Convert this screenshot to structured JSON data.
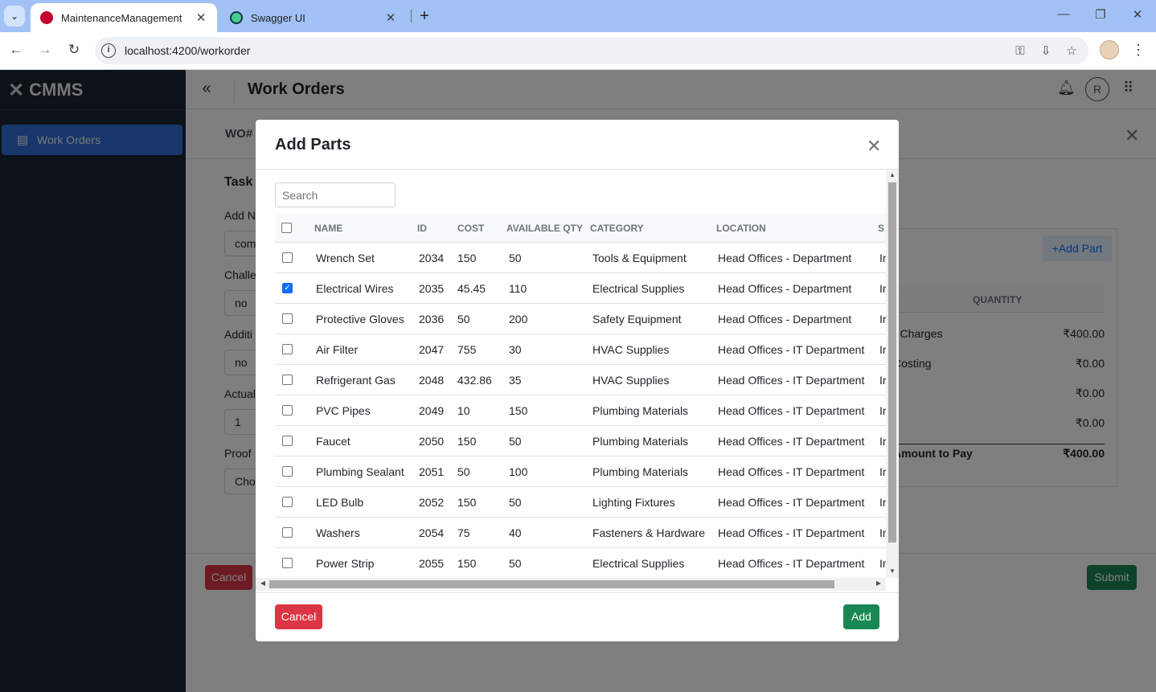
{
  "browser": {
    "tabs": [
      {
        "title": "MaintenanceManagement",
        "active": true
      },
      {
        "title": "Swagger UI",
        "active": false
      }
    ],
    "url": "localhost:4200/workorder",
    "icons": {
      "back": "←",
      "forward": "→",
      "reload": "↻",
      "key": "⚿",
      "install": "⇩",
      "star": "☆",
      "menu": "⋮",
      "close": "✕",
      "plus": "+",
      "minimize": "—",
      "restore": "❐"
    }
  },
  "sidebar": {
    "brand": "CMMS",
    "items": [
      {
        "label": "Work Orders",
        "icon": "clipboard-icon"
      }
    ]
  },
  "header": {
    "title": "Work Orders",
    "avatar_initial": "R"
  },
  "workorder": {
    "id_label": "WO#",
    "task_label": "Task",
    "fields": [
      {
        "label": "Add N",
        "value": "com"
      },
      {
        "label": "Challe",
        "value": "no"
      },
      {
        "label": "Additi",
        "value": "no"
      },
      {
        "label": "Actual",
        "value": "1"
      },
      {
        "label": "Proof",
        "value": "Cho"
      }
    ],
    "cancel_label": "Cancel",
    "submit_label": "Submit",
    "add_part_label": "+Add Part",
    "cost_columns": [
      "T",
      "QUANTITY"
    ],
    "cost_rows": [
      {
        "label": "r Charges",
        "value": "₹400.00"
      },
      {
        "label": "Costing",
        "value": "₹0.00"
      },
      {
        "label": "",
        "value": "₹0.00"
      },
      {
        "label": "",
        "value": "₹0.00"
      }
    ],
    "total": {
      "label": "Amount to Pay",
      "value": "₹400.00"
    }
  },
  "modal": {
    "title": "Add Parts",
    "search_placeholder": "Search",
    "columns": [
      "NAME",
      "ID",
      "COST",
      "AVAILABLE QTY",
      "CATEGORY",
      "LOCATION",
      "S"
    ],
    "rows": [
      {
        "name": "Wrench Set",
        "id": "2034",
        "cost": "150",
        "qty": "50",
        "category": "Tools & Equipment",
        "location": "Head Offices - Department",
        "status": "Ir",
        "checked": false
      },
      {
        "name": "Electrical Wires",
        "id": "2035",
        "cost": "45.45",
        "qty": "110",
        "category": "Electrical Supplies",
        "location": "Head Offices - Department",
        "status": "Ir",
        "checked": true
      },
      {
        "name": "Protective Gloves",
        "id": "2036",
        "cost": "50",
        "qty": "200",
        "category": "Safety Equipment",
        "location": "Head Offices - Department",
        "status": "Ir",
        "checked": false
      },
      {
        "name": "Air Filter",
        "id": "2047",
        "cost": "755",
        "qty": "30",
        "category": "HVAC Supplies",
        "location": "Head Offices - IT Department",
        "status": "Ir",
        "checked": false
      },
      {
        "name": "Refrigerant Gas",
        "id": "2048",
        "cost": "432.86",
        "qty": "35",
        "category": "HVAC Supplies",
        "location": "Head Offices - IT Department",
        "status": "Ir",
        "checked": false
      },
      {
        "name": "PVC Pipes",
        "id": "2049",
        "cost": "10",
        "qty": "150",
        "category": "Plumbing Materials",
        "location": "Head Offices - IT Department",
        "status": "Ir",
        "checked": false
      },
      {
        "name": "Faucet",
        "id": "2050",
        "cost": "150",
        "qty": "50",
        "category": "Plumbing Materials",
        "location": "Head Offices - IT Department",
        "status": "Ir",
        "checked": false
      },
      {
        "name": "Plumbing Sealant",
        "id": "2051",
        "cost": "50",
        "qty": "100",
        "category": "Plumbing Materials",
        "location": "Head Offices - IT Department",
        "status": "Ir",
        "checked": false
      },
      {
        "name": "LED Bulb",
        "id": "2052",
        "cost": "150",
        "qty": "50",
        "category": "Lighting Fixtures",
        "location": "Head Offices - IT Department",
        "status": "Ir",
        "checked": false
      },
      {
        "name": "Washers",
        "id": "2054",
        "cost": "75",
        "qty": "40",
        "category": "Fasteners & Hardware",
        "location": "Head Offices - IT Department",
        "status": "Ir",
        "checked": false
      },
      {
        "name": "Power Strip",
        "id": "2055",
        "cost": "150",
        "qty": "50",
        "category": "Electrical Supplies",
        "location": "Head Offices - IT Department",
        "status": "Ir",
        "checked": false
      }
    ],
    "cancel_label": "Cancel",
    "add_label": "Add"
  },
  "colors": {
    "accent": "#2f6fd6",
    "danger": "#dc3545",
    "success": "#198754",
    "sidebar": "#1b2231"
  }
}
